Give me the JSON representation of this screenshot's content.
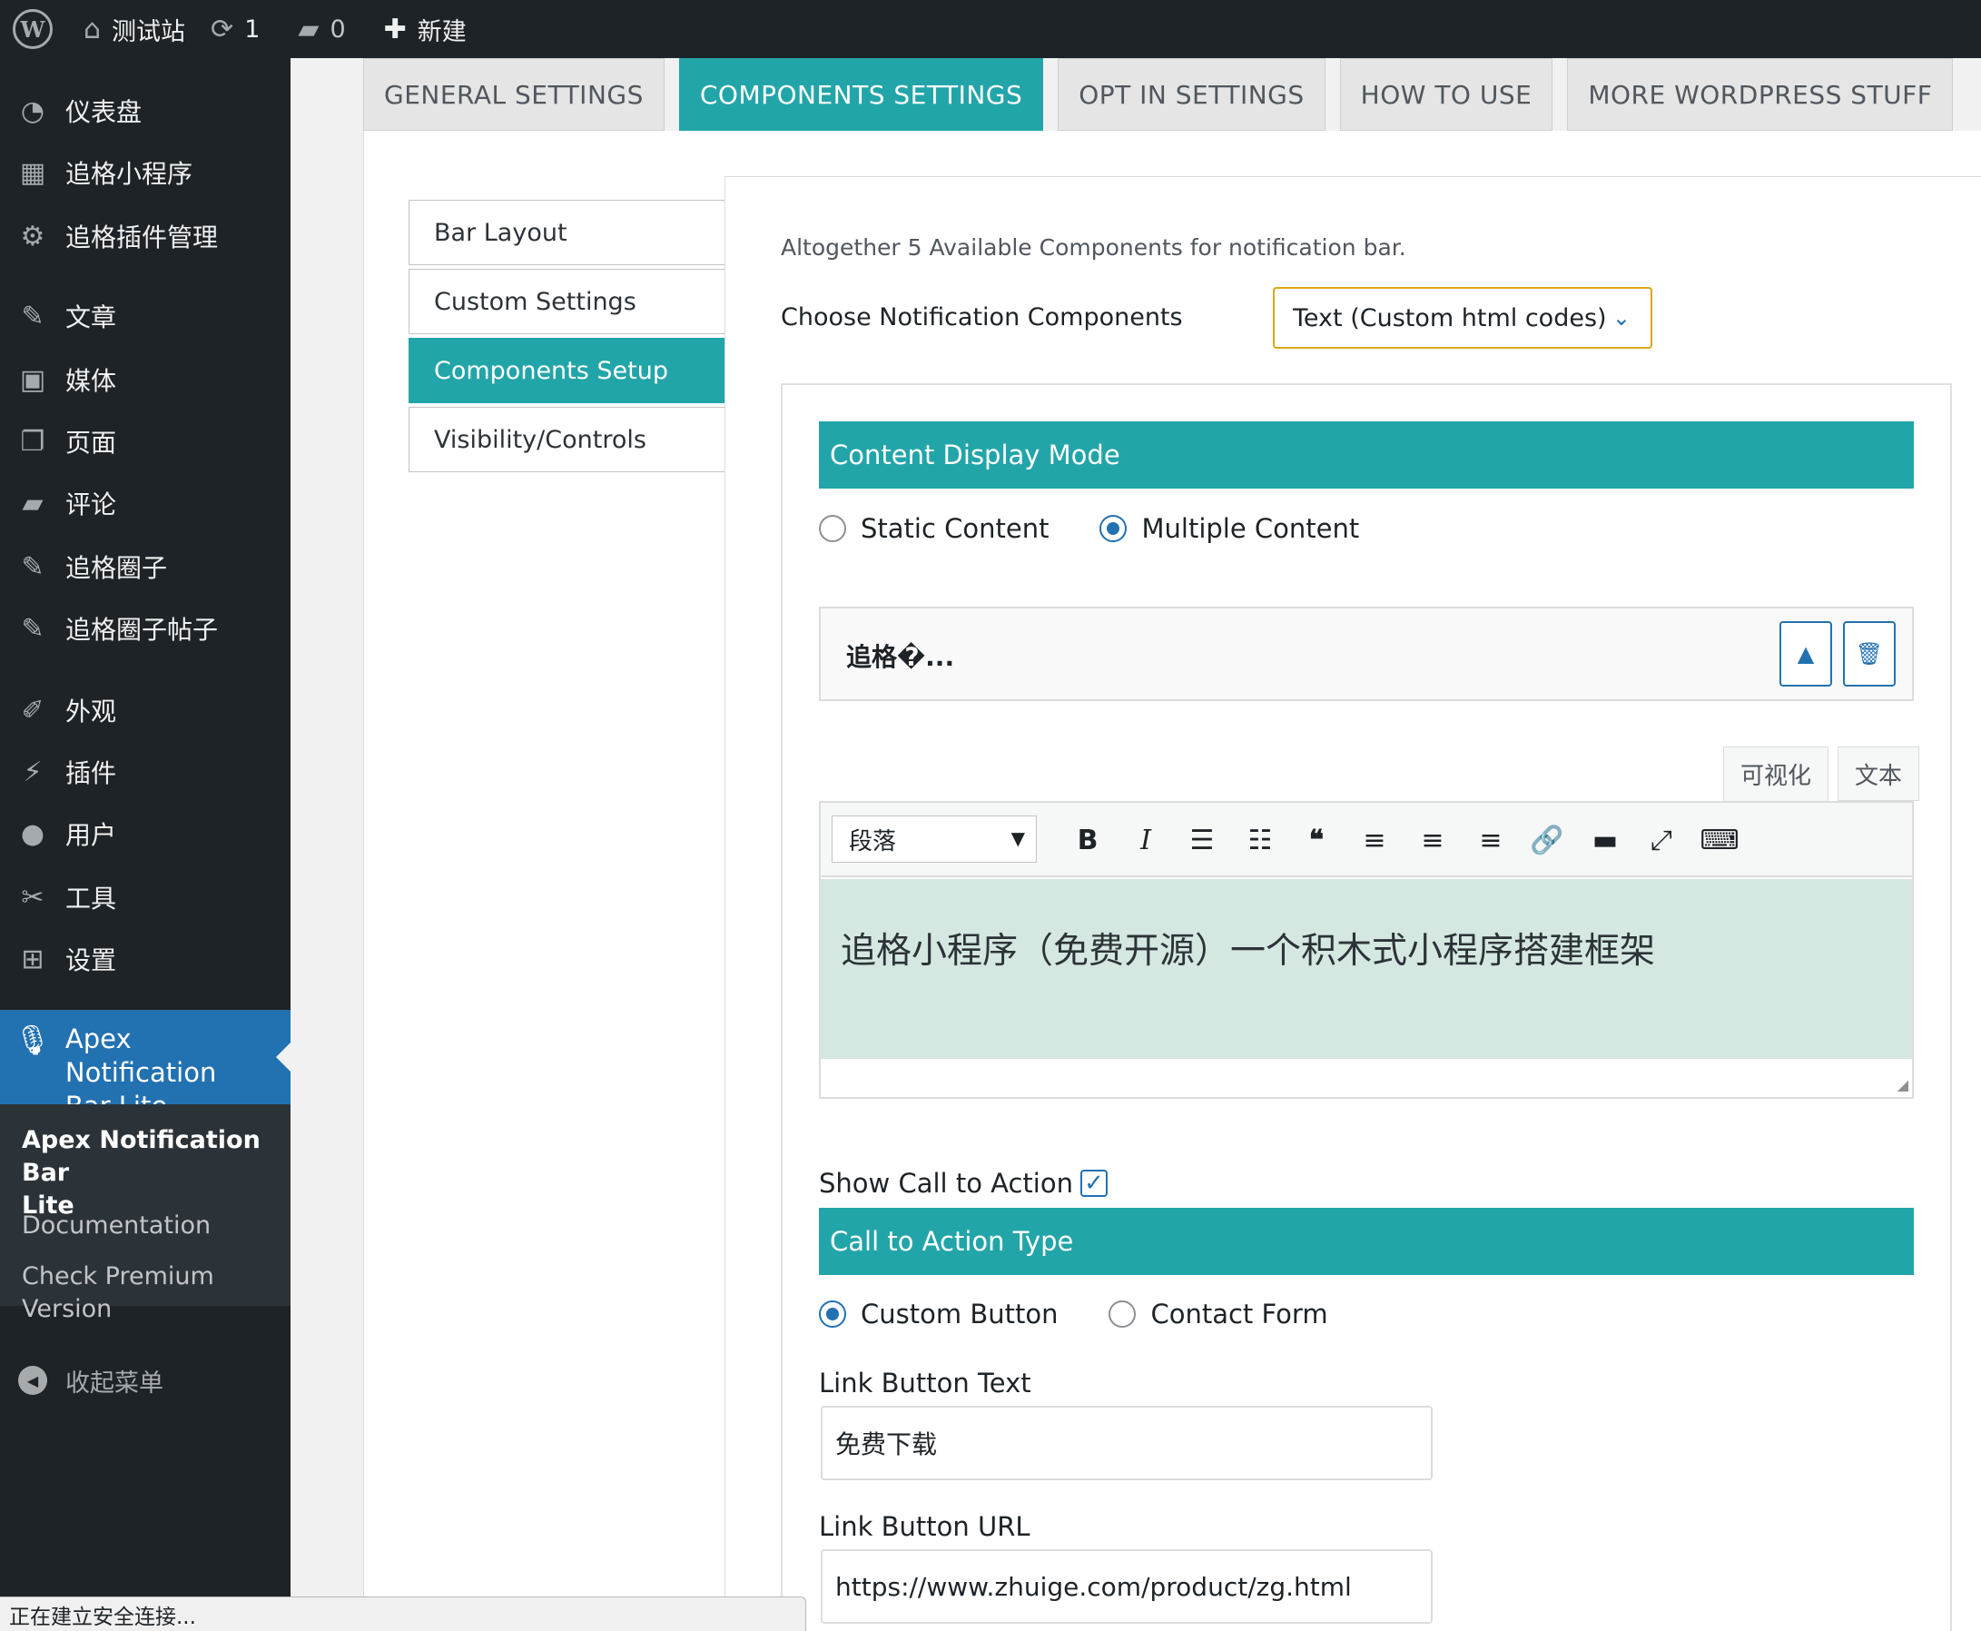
{
  "adminbar": {
    "wp_logo": "W",
    "site_name": "测试站",
    "updates_count": "1",
    "comments_count": "0",
    "new_label": "新建",
    "icons": {
      "home": "home-icon",
      "updates": "refresh-icon",
      "comments": "comment-icon",
      "new": "plus-icon"
    }
  },
  "sidebar": {
    "items": [
      {
        "label": "仪表盘",
        "icon": "◔"
      },
      {
        "label": "追格小程序",
        "icon": "▦"
      },
      {
        "label": "追格插件管理",
        "icon": "⚙"
      },
      {
        "label": "文章",
        "icon": "✎"
      },
      {
        "label": "媒体",
        "icon": "▣"
      },
      {
        "label": "页面",
        "icon": "❐"
      },
      {
        "label": "评论",
        "icon": "▰"
      },
      {
        "label": "追格圈子",
        "icon": "✎"
      },
      {
        "label": "追格圈子帖子",
        "icon": "✎"
      },
      {
        "label": "外观",
        "icon": "✐"
      },
      {
        "label": "插件",
        "icon": "⚡"
      },
      {
        "label": "用户",
        "icon": "●"
      },
      {
        "label": "工具",
        "icon": "✂"
      },
      {
        "label": "设置",
        "icon": "⊞"
      }
    ],
    "current": {
      "label_line1": "Apex Notification",
      "label_line2": "Bar Lite",
      "icon": "🎙"
    },
    "submenu": {
      "head_line1": "Apex Notification Bar",
      "head_line2": "Lite",
      "documentation": "Documentation",
      "premium_line1": "Check Premium",
      "premium_line2": "Version"
    },
    "collapse_label": "收起菜单"
  },
  "status_bar": "正在建立安全连接...",
  "tabs": [
    {
      "label": "GENERAL SETTINGS",
      "active": false
    },
    {
      "label": "COMPONENTS SETTINGS",
      "active": true
    },
    {
      "label": "OPT IN SETTINGS",
      "active": false
    },
    {
      "label": "HOW TO USE",
      "active": false
    },
    {
      "label": "MORE WORDPRESS STUFF",
      "active": false
    }
  ],
  "vtabs": [
    {
      "label": "Bar Layout",
      "active": false
    },
    {
      "label": "Custom Settings",
      "active": false
    },
    {
      "label": "Components Setup",
      "active": true
    },
    {
      "label": "Visibility/Controls",
      "active": false
    }
  ],
  "components": {
    "note": "Altogether 5 Available Components for notification bar.",
    "choose_label": "Choose Notification Components",
    "selected_component": "Text (Custom html codes)"
  },
  "display_mode": {
    "heading": "Content Display Mode",
    "options": [
      {
        "label": "Static Content",
        "checked": false
      },
      {
        "label": "Multiple Content",
        "checked": true
      }
    ]
  },
  "content_item": {
    "title": "追格�...",
    "move_up_icon": "▲",
    "delete_icon": "🗑"
  },
  "editor": {
    "tab_visual": "可视化",
    "tab_text": "文本",
    "format_value": "段落",
    "content": "追格小程序（免费开源）一个积木式小程序搭建框架",
    "toolbar_buttons": [
      "B",
      "I",
      "☰",
      "☷",
      "❝",
      "≡",
      "≡",
      "≡",
      "🔗",
      "▬",
      "⤢",
      "⌨"
    ]
  },
  "cta": {
    "show_label": "Show Call to Action",
    "show_checked": true,
    "type_heading": "Call to Action Type",
    "options": [
      {
        "label": "Custom Button",
        "checked": true
      },
      {
        "label": "Contact Form",
        "checked": false
      }
    ],
    "link_text_label": "Link Button Text",
    "link_text_value": "免费下载",
    "link_url_label": "Link Button URL",
    "link_url_value": "https://www.zhuige.com/product/zg.html"
  },
  "colors": {
    "accent": "#22a5a9",
    "admin_dark": "#1d2327",
    "wp_blue": "#2271b1",
    "select_border": "#dba617",
    "editor_bg": "#d4e7e1"
  }
}
